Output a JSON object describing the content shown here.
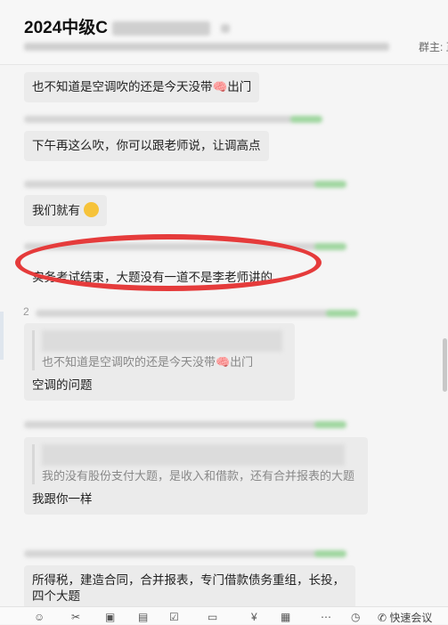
{
  "header": {
    "title": "2024中级C",
    "owner": "群主: 正"
  },
  "messages": [
    {
      "text": "也不知道是空调吹的还是今天没带🧠出门"
    },
    {
      "text": "下午再这么吹，你可以跟老师说，让调高点"
    },
    {
      "text": "我们就有"
    },
    {
      "text": "实务考试结束，大题没有一道不是李老师讲的"
    },
    {
      "quote": "也不知道是空调吹的还是今天没带🧠出门",
      "text": "空调的问题",
      "sender_prefix": "2"
    },
    {
      "quote": "我的没有股份支付大题，是收入和借款，还有合并报表的大题",
      "text": "我跟你一样"
    },
    {
      "text": "所得税，建造合同，合并报表，专门借款债务重组，长投，四个大题"
    }
  ],
  "toolbar": {
    "icons": [
      "emoji-icon",
      "scissors-icon",
      "image-icon",
      "document-icon",
      "check-icon",
      "folder-icon",
      "yen-icon",
      "gif-icon",
      "more-icon",
      "clock-icon",
      "phone-icon"
    ],
    "meeting_label": "快速会议"
  }
}
